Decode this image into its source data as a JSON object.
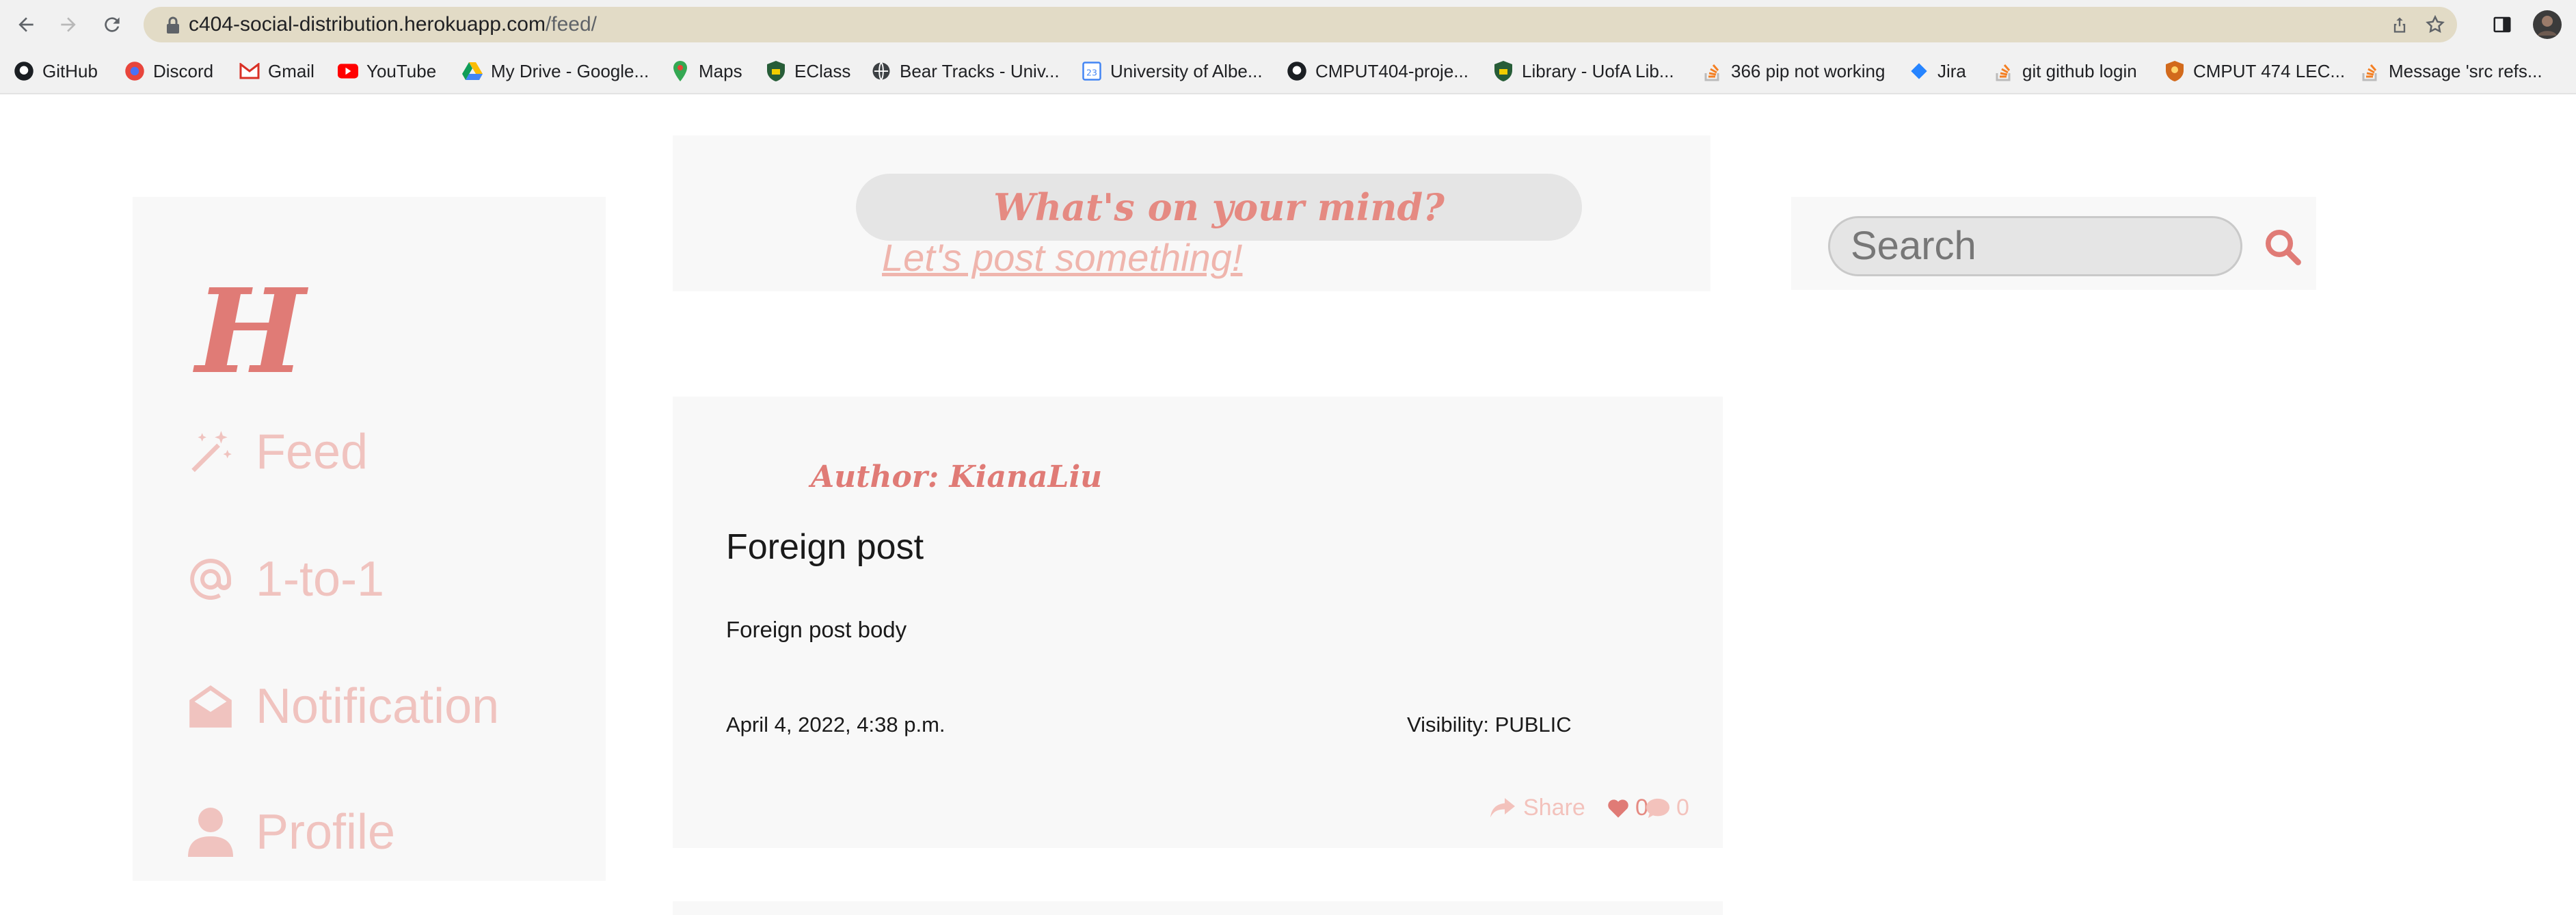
{
  "browser": {
    "url_host": "c404-social-distribution.herokuapp.com",
    "url_path": "/feed/",
    "bookmarks": [
      {
        "label": "GitHub",
        "icon": "github-icon"
      },
      {
        "label": "Discord",
        "icon": "discord-icon"
      },
      {
        "label": "Gmail",
        "icon": "gmail-icon"
      },
      {
        "label": "YouTube",
        "icon": "youtube-icon"
      },
      {
        "label": "My Drive - Google...",
        "icon": "drive-icon"
      },
      {
        "label": "Maps",
        "icon": "maps-icon"
      },
      {
        "label": "EClass",
        "icon": "shield-icon"
      },
      {
        "label": "Bear Tracks - Univ...",
        "icon": "globe-icon"
      },
      {
        "label": "University of Albe...",
        "icon": "calendar-icon"
      },
      {
        "label": "CMPUT404-proje...",
        "icon": "github-icon"
      },
      {
        "label": "Library - UofA Lib...",
        "icon": "shield-icon"
      },
      {
        "label": "366 pip not working",
        "icon": "stackoverflow-icon"
      },
      {
        "label": "Jira",
        "icon": "jira-icon"
      },
      {
        "label": "git github login",
        "icon": "stackoverflow-icon"
      },
      {
        "label": "CMPUT 474 LEC...",
        "icon": "crest-icon"
      },
      {
        "label": "Message 'src refs...",
        "icon": "stackoverflow-icon"
      }
    ]
  },
  "app": {
    "logo": "H",
    "nav": [
      {
        "label": "Feed",
        "icon": "magic-wand-icon"
      },
      {
        "label": "1-to-1",
        "icon": "at-icon"
      },
      {
        "label": "Notification",
        "icon": "envelope-open-icon"
      },
      {
        "label": "Profile",
        "icon": "user-icon"
      }
    ],
    "composer": {
      "prompt": "What's on your mind?",
      "link": "Let's post something!"
    },
    "search": {
      "placeholder": "Search"
    },
    "post": {
      "author": "Author: KianaLiu",
      "title": "Foreign post",
      "body": "Foreign post body",
      "date": "April 4, 2022, 4:38 p.m.",
      "visibility": "Visibility: PUBLIC",
      "share_label": "Share",
      "likes": "0",
      "comments": "0"
    },
    "colors": {
      "accent": "#e07b76",
      "muted": "#f0c3bf",
      "panel": "#f8f8f8"
    }
  }
}
